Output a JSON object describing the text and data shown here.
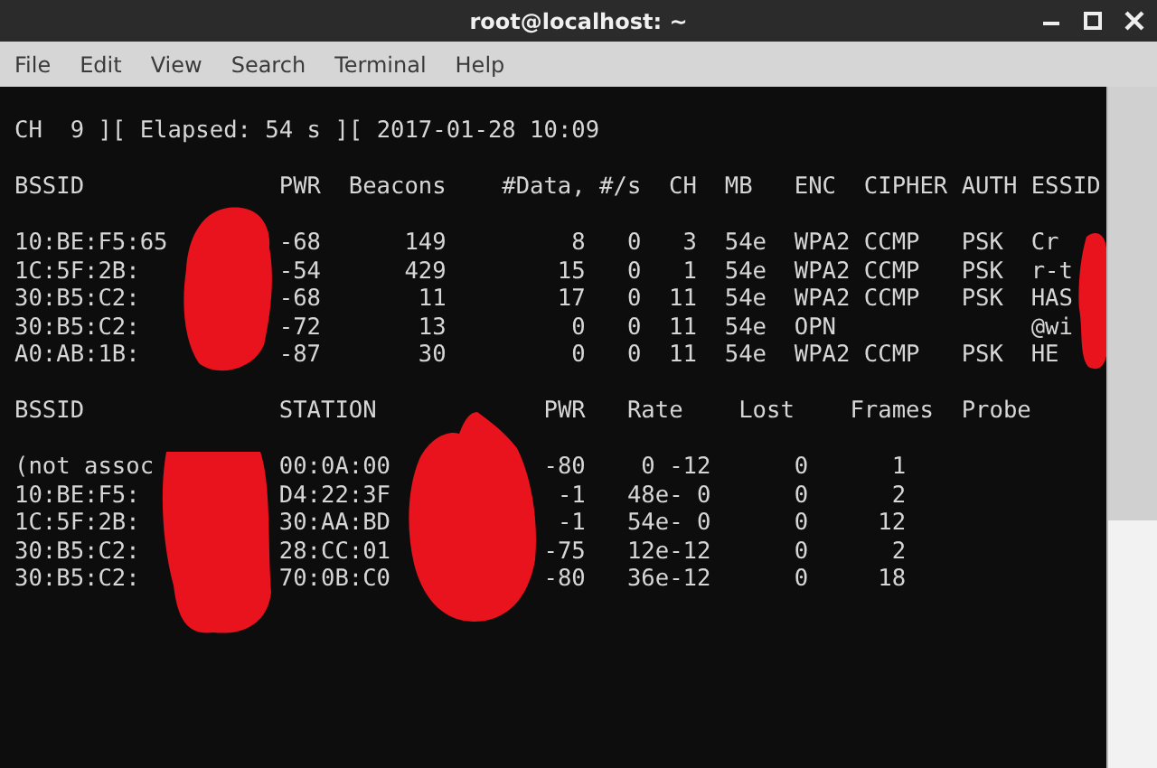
{
  "window": {
    "title": "root@localhost: ~"
  },
  "menu": [
    "File",
    "Edit",
    "View",
    "Search",
    "Terminal",
    "Help"
  ],
  "terminal": {
    "status_line": "CH  9 ][ Elapsed: 54 s ][ 2017-01-28 10:09",
    "access_points": {
      "columns": [
        "BSSID",
        "PWR",
        "Beacons",
        "#Data,",
        "#/s",
        "CH",
        "MB",
        "ENC",
        "CIPHER",
        "AUTH",
        "ESSID"
      ],
      "rows": [
        {
          "bssid": "10:BE:F5:65",
          "pwr": "-68",
          "beacons": "149",
          "data": "8",
          "per_s": "0",
          "ch": "3",
          "mb": "54e",
          "enc": "WPA2",
          "cipher": "CCMP",
          "auth": "PSK",
          "essid": "Cr"
        },
        {
          "bssid": "1C:5F:2B:",
          "pwr": "-54",
          "beacons": "429",
          "data": "15",
          "per_s": "0",
          "ch": "1",
          "mb": "54e",
          "enc": "WPA2",
          "cipher": "CCMP",
          "auth": "PSK",
          "essid": "r-t"
        },
        {
          "bssid": "30:B5:C2:",
          "pwr": "-68",
          "beacons": "11",
          "data": "17",
          "per_s": "0",
          "ch": "11",
          "mb": "54e",
          "enc": "WPA2",
          "cipher": "CCMP",
          "auth": "PSK",
          "essid": "HAS"
        },
        {
          "bssid": "30:B5:C2:",
          "pwr": "-72",
          "beacons": "13",
          "data": "0",
          "per_s": "0",
          "ch": "11",
          "mb": "54e",
          "enc": "OPN",
          "essid": "@wi"
        },
        {
          "bssid": "A0:AB:1B:",
          "pwr": "-87",
          "beacons": "30",
          "data": "0",
          "per_s": "0",
          "ch": "11",
          "mb": "54e",
          "enc": "WPA2",
          "cipher": "CCMP",
          "auth": "PSK",
          "essid": "HE"
        }
      ]
    },
    "stations": {
      "columns": [
        "BSSID",
        "STATION",
        "PWR",
        "Rate",
        "Lost",
        "Frames",
        "Probe"
      ],
      "rows": [
        {
          "bssid": "(not assoc",
          "station": "00:0A:00",
          "pwr": "-80",
          "rate": "0 -12",
          "lost": "0",
          "frames": "1"
        },
        {
          "bssid": "10:BE:F5:",
          "station": "D4:22:3F",
          "pwr": "-1",
          "rate": "48e- 0",
          "lost": "0",
          "frames": "2"
        },
        {
          "bssid": "1C:5F:2B:",
          "station": "30:AA:BD",
          "pwr": "-1",
          "rate": "54e- 0",
          "lost": "0",
          "frames": "12"
        },
        {
          "bssid": "30:B5:C2:",
          "station": "28:CC:01",
          "pwr": "-75",
          "rate": "12e-12",
          "lost": "0",
          "frames": "2"
        },
        {
          "bssid": "30:B5:C2:",
          "station": "70:0B:C0",
          "pwr": "-80",
          "rate": "36e-12",
          "lost": "0",
          "frames": "18"
        }
      ]
    }
  }
}
